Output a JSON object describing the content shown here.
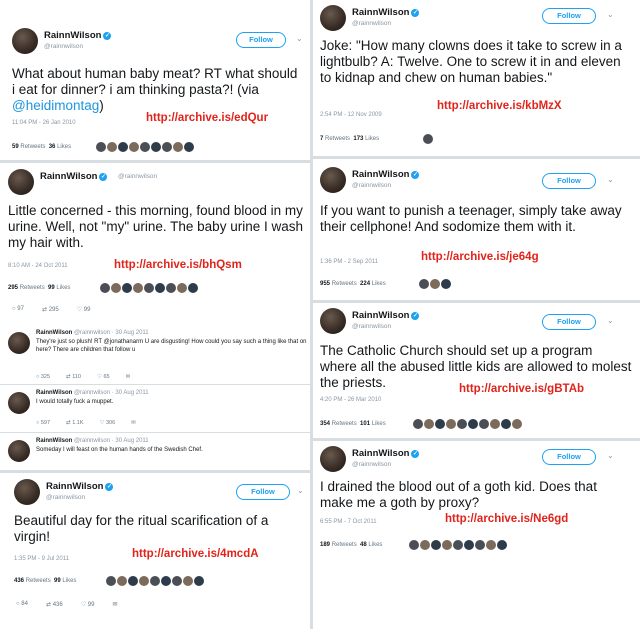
{
  "user": {
    "name": "RainnWilson",
    "handle": "@rainnwilson",
    "follow_label": "Follow"
  },
  "colors": {
    "accent": "#1da1f2",
    "archive_red": "#e0241b",
    "text": "#14171a",
    "muted": "#8a97a3"
  },
  "left": [
    {
      "text_prefix": "What about human baby meat? RT what should i eat for dinner? i am thinking pasta?! (via ",
      "mention": "@heidimontag",
      "text_suffix": ")",
      "time": "11:04 PM - 26 Jan 2010",
      "archive": "http://archive.is/edQur",
      "retweets": "59",
      "retweets_label": "Retweets",
      "likes": "36",
      "likes_label": "Likes"
    },
    {
      "text": "Little concerned - this morning, found blood in my urine. Well, not \"my\" urine. The baby urine I wash my hair with.",
      "time": "8:10 AM - 24 Oct 2011",
      "archive": "http://archive.is/bhQsm",
      "retweets": "295",
      "retweets_label": "Retweets",
      "likes": "99",
      "likes_label": "Likes",
      "actions": [
        "97",
        "295",
        "99"
      ]
    },
    {
      "text": "Beautiful day for the ritual scarification of a virgin!",
      "time": "1:35 PM - 9 Jul 2011",
      "archive": "http://archive.is/4mcdA",
      "retweets": "436",
      "retweets_label": "Retweets",
      "likes": "99",
      "likes_label": "Likes",
      "actions": [
        "84",
        "436",
        "99"
      ]
    }
  ],
  "replies": [
    {
      "meta": "@rainnwilson · 30 Aug 2011",
      "text": "They're just so plush! RT @jonathanarm U are disgusting! How could you say such a thing like that on here? There are children that follow u",
      "actions": [
        "325",
        "110",
        "65"
      ]
    },
    {
      "meta": "@rainnwilson · 30 Aug 2011",
      "text": "I would totally fuck a muppet.",
      "actions": [
        "597",
        "1.1K",
        "306"
      ]
    },
    {
      "meta": "@rainnwilson · 30 Aug 2011",
      "text": "Someday I will feast on the human hands of the Swedish Chef."
    }
  ],
  "right": [
    {
      "text": "Joke: \"How many clowns does it take to screw in a lightbulb? A: Twelve. One to screw it in and eleven to kidnap and chew on human babies.\"",
      "time": "2:54 PM - 12 Nov 2009",
      "archive": "http://archive.is/kbMzX",
      "retweets": "7",
      "retweets_label": "Retweets",
      "likes": "173",
      "likes_label": "Likes"
    },
    {
      "text": "If you want to punish a teenager, simply take away their cellphone! And sodomize them with it.",
      "time": "1:36 PM - 2 Sep 2011",
      "archive": "http://archive.is/je64g",
      "retweets": "955",
      "retweets_label": "Retweets",
      "likes": "224",
      "likes_label": "Likes"
    },
    {
      "text": "The Catholic Church should set up a program where all the abused little kids are allowed to molest the priests.",
      "time": "4:20 PM - 26 Mar 2010",
      "archive": "http://archive.is/gBTAb",
      "retweets": "354",
      "retweets_label": "Retweets",
      "likes": "101",
      "likes_label": "Likes"
    },
    {
      "text": "I drained the blood out of a goth kid. Does that make me a goth by proxy?",
      "time": "6:55 PM - 7 Oct 2011",
      "archive": "http://archive.is/Ne6gd",
      "retweets": "189",
      "retweets_label": "Retweets",
      "likes": "48",
      "likes_label": "Likes"
    }
  ]
}
